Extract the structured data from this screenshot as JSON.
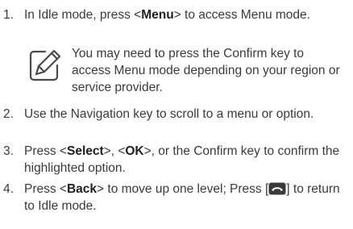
{
  "steps": [
    {
      "number": "1.",
      "parts": [
        "In Idle mode, press <",
        "Menu",
        "> to access Menu mode."
      ]
    },
    {
      "number": "2.",
      "text": "Use the Navigation key to scroll to a menu or option."
    },
    {
      "number": "3.",
      "parts": [
        "Press <",
        "Select",
        ">, <",
        "OK",
        ">, or the Confirm key to confirm the highlighted option."
      ]
    },
    {
      "number": "4.",
      "parts": [
        "Press <",
        "Back",
        "> to move up one level; Press [",
        "] to return to Idle mode."
      ]
    }
  ],
  "note": {
    "icon": "note-pencil-icon",
    "text": "You may need to press the Confirm key to access Menu mode depending on your region or service provider."
  },
  "colors": {
    "text": "#3a3a3a",
    "icon": "#4a4a4a"
  }
}
